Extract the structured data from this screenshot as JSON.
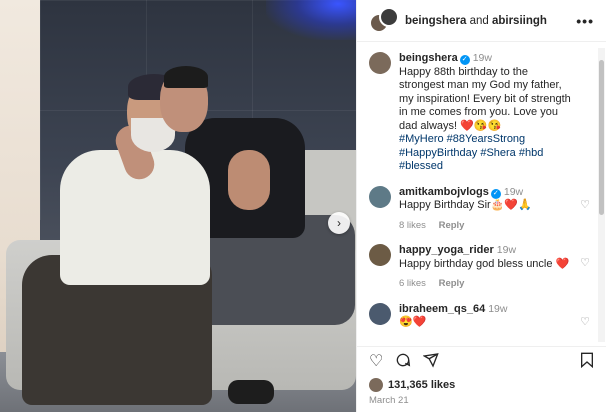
{
  "header": {
    "user1": "beingshera",
    "and": "and",
    "user2": "abirsiingh",
    "more": "•••"
  },
  "photo": {
    "next_icon": "chevron-right-icon",
    "next_glyph": "›"
  },
  "caption": {
    "user": "beingshera",
    "time": "19w",
    "text": "Happy 88th birthday to the strongest man my God my father, my inspiration! Every bit of strength in me comes from you. Love you dad always! ❤️😘😘",
    "tags": "#MyHero #88YearsStrong #HappyBirthday #Shera #hbd #blessed"
  },
  "comments": [
    {
      "user": "amitkambojvlogs",
      "verified": true,
      "time": "19w",
      "text": "Happy Birthday Sir🎂❤️🙏",
      "likes": "8 likes",
      "reply": "Reply",
      "avatar_color": "#5e7a87"
    },
    {
      "user": "happy_yoga_rider",
      "verified": false,
      "time": "19w",
      "text": "Happy birthday god bless uncle ❤️",
      "likes": "6 likes",
      "reply": "Reply",
      "avatar_color": "#6c5b45"
    },
    {
      "user": "ibraheem_qs_64",
      "verified": false,
      "time": "19w",
      "text": "😍❤️",
      "likes": "",
      "reply": "",
      "avatar_color": "#4b5a6e"
    }
  ],
  "actions": {
    "like_icon": "heart-icon",
    "comment_icon": "comment-icon",
    "share_icon": "share-icon",
    "save_icon": "bookmark-icon"
  },
  "likes_count": "131,365 likes",
  "date": "March 21"
}
